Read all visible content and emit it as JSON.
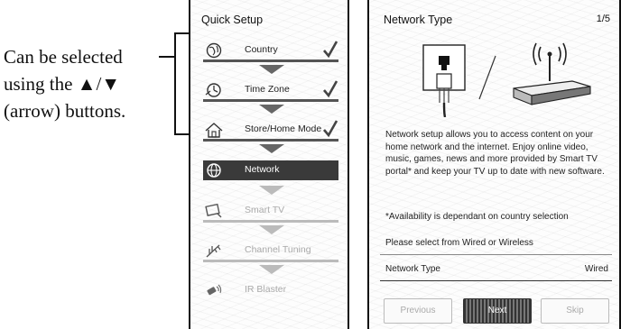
{
  "callout": {
    "line1": "Can be selected",
    "line2": "using the ▲/▼",
    "line3": "(arrow) buttons."
  },
  "quick_setup": {
    "title": "Quick Setup",
    "items": [
      {
        "label": "Country",
        "icon": "globe-icon",
        "state": "done"
      },
      {
        "label": "Time Zone",
        "icon": "time-zone-icon",
        "state": "done"
      },
      {
        "label": "Store/Home Mode",
        "icon": "home-icon",
        "state": "done"
      },
      {
        "label": "Network",
        "icon": "network-globe-icon",
        "state": "active"
      },
      {
        "label": "Smart TV",
        "icon": "smart-tv-icon",
        "state": "pending"
      },
      {
        "label": "Channel Tuning",
        "icon": "antenna-icon",
        "state": "pending"
      },
      {
        "label": "IR Blaster",
        "icon": "ir-blaster-icon",
        "state": "pending"
      }
    ]
  },
  "network_type": {
    "title": "Network Type",
    "page": "1/5",
    "description": "Network setup allows you to access content on your home network and the internet. Enjoy online video, music, games, news and more provided by Smart TV portal* and keep your TV up to date with new software.",
    "footnote": "*Availability is dependant on country selection",
    "prompt": "Please select from Wired or Wireless",
    "field_label": "Network Type",
    "field_value": "Wired",
    "buttons": {
      "previous": "Previous",
      "next": "Next",
      "skip": "Skip"
    }
  }
}
